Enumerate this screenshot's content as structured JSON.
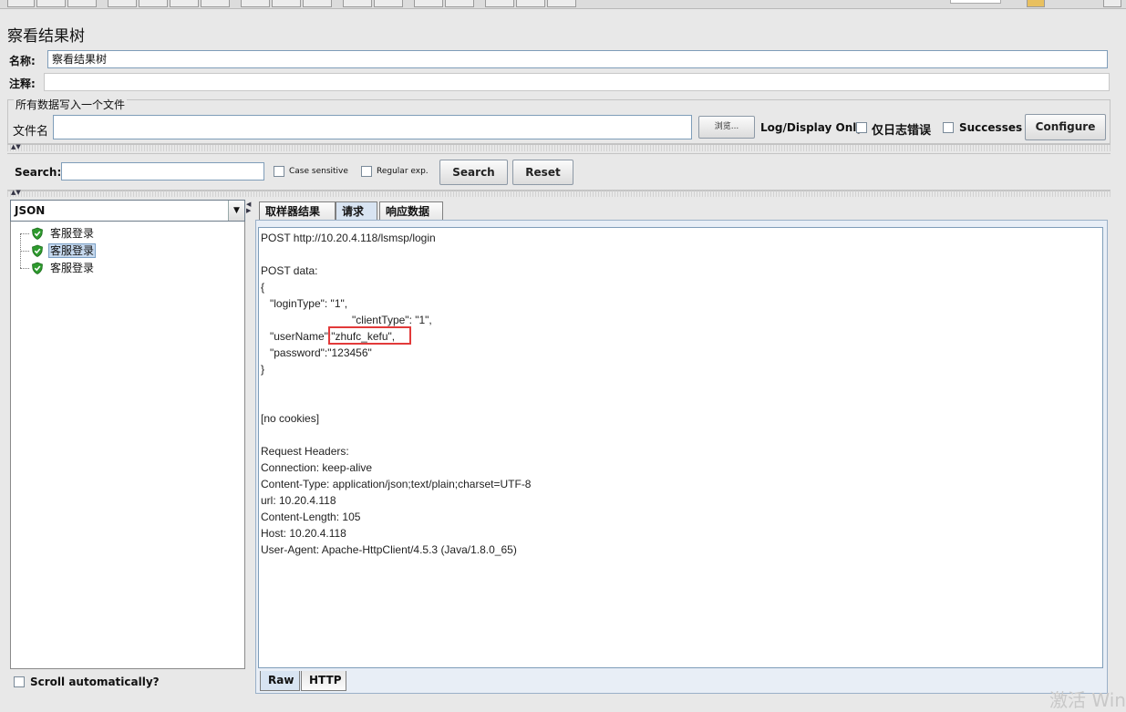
{
  "panel_title": "察看结果树",
  "name_label": "名称:",
  "name_value": "察看结果树",
  "comment_label": "注释:",
  "comment_value": "",
  "file_group_title": "所有数据写入一个文件",
  "filename_label": "文件名",
  "filename_value": "",
  "browse_label": "浏览...",
  "log_display_label": "Log/Display Only:",
  "errors_only_label": "仅日志错误",
  "successes_label": "Successes",
  "configure_label": "Configure",
  "search": {
    "label": "Search:",
    "value": "",
    "case_sensitive_label": "Case sensitive",
    "regex_label": "Regular exp.",
    "search_button": "Search",
    "reset_button": "Reset"
  },
  "renderer_selected": "JSON",
  "tree_items": [
    {
      "label": "客服登录",
      "status": "success",
      "selected": false
    },
    {
      "label": "客服登录",
      "status": "success",
      "selected": true
    },
    {
      "label": "客服登录",
      "status": "success",
      "selected": false
    }
  ],
  "scroll_auto_label": "Scroll automatically?",
  "tabs": [
    "取样器结果",
    "请求",
    "响应数据"
  ],
  "active_tab": "请求",
  "request_text": "POST http://10.20.4.118/lsmsp/login\n\nPOST data:\n{\n   \"loginType\": \"1\",\n                              \"clientType\": \"1\",\n   \"userName\":\"zhufc_kefu\",\n   \"password\":\"123456\"\n}\n\n\n[no cookies]\n\nRequest Headers:\nConnection: keep-alive\nContent-Type: application/json;text/plain;charset=UTF-8\nurl: 10.20.4.118\nContent-Length: 105\nHost: 10.20.4.118\nUser-Agent: Apache-HttpClient/4.5.3 (Java/1.8.0_65)",
  "bottom_tabs": [
    "Raw",
    "HTTP"
  ],
  "active_bottom_tab": "Raw",
  "watermark_text": "激活 Win",
  "colors": {
    "accent": "#d8e4f2",
    "highlight_box": "#e23a3a",
    "success_icon": "#2e9a2e"
  }
}
